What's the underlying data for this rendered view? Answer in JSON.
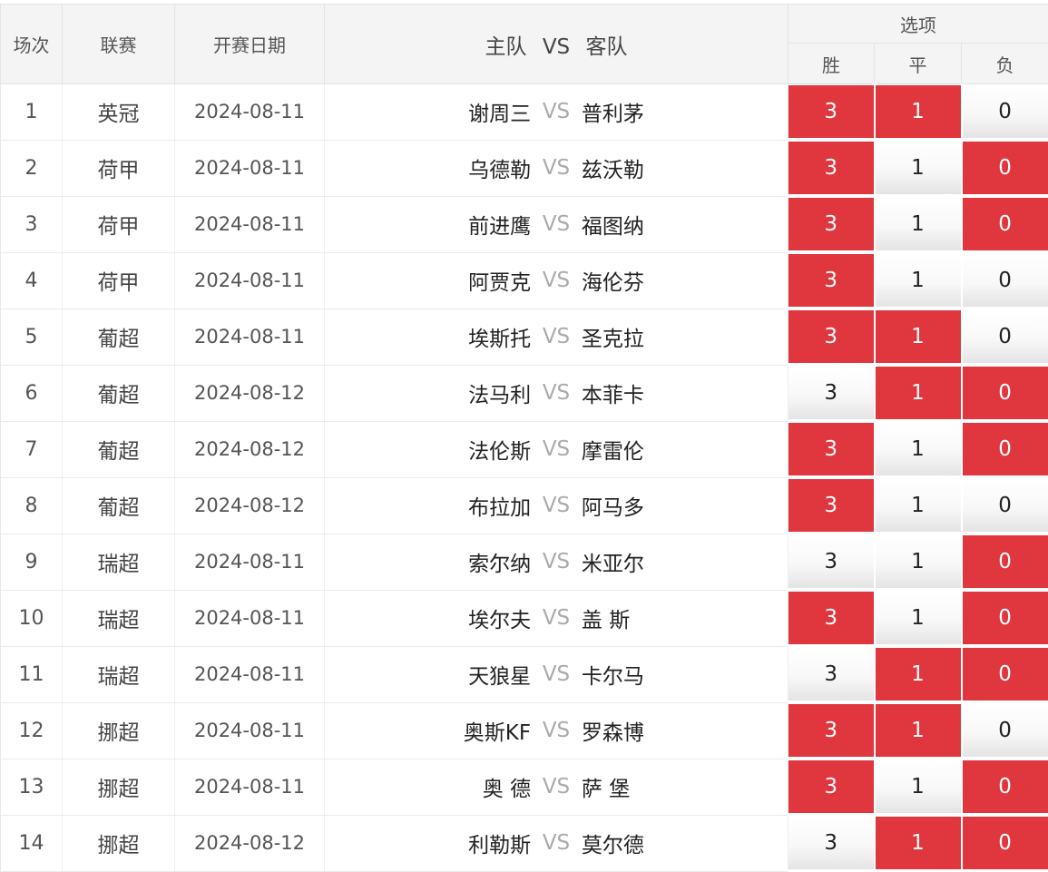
{
  "header": {
    "index": "场次",
    "league": "联赛",
    "date": "开赛日期",
    "match": {
      "home": "主队",
      "vs": "VS",
      "away": "客队"
    },
    "options": "选项",
    "win": "胜",
    "draw": "平",
    "lose": "负"
  },
  "vs_label": "VS",
  "colors": {
    "selected": "#e0363d",
    "vs_text": "#aaaaaa"
  },
  "rows": [
    {
      "index": "1",
      "league": "英冠",
      "date": "2024-08-11",
      "home": "谢周三",
      "away": "普利茅",
      "win": "3",
      "draw": "1",
      "lose": "0",
      "win_sel": true,
      "draw_sel": true,
      "lose_sel": false
    },
    {
      "index": "2",
      "league": "荷甲",
      "date": "2024-08-11",
      "home": "乌德勒",
      "away": "兹沃勒",
      "win": "3",
      "draw": "1",
      "lose": "0",
      "win_sel": true,
      "draw_sel": false,
      "lose_sel": true
    },
    {
      "index": "3",
      "league": "荷甲",
      "date": "2024-08-11",
      "home": "前进鹰",
      "away": "福图纳",
      "win": "3",
      "draw": "1",
      "lose": "0",
      "win_sel": true,
      "draw_sel": false,
      "lose_sel": true
    },
    {
      "index": "4",
      "league": "荷甲",
      "date": "2024-08-11",
      "home": "阿贾克",
      "away": "海伦芬",
      "win": "3",
      "draw": "1",
      "lose": "0",
      "win_sel": true,
      "draw_sel": false,
      "lose_sel": false
    },
    {
      "index": "5",
      "league": "葡超",
      "date": "2024-08-11",
      "home": "埃斯托",
      "away": "圣克拉",
      "win": "3",
      "draw": "1",
      "lose": "0",
      "win_sel": true,
      "draw_sel": true,
      "lose_sel": false
    },
    {
      "index": "6",
      "league": "葡超",
      "date": "2024-08-12",
      "home": "法马利",
      "away": "本菲卡",
      "win": "3",
      "draw": "1",
      "lose": "0",
      "win_sel": false,
      "draw_sel": true,
      "lose_sel": true
    },
    {
      "index": "7",
      "league": "葡超",
      "date": "2024-08-12",
      "home": "法伦斯",
      "away": "摩雷伦",
      "win": "3",
      "draw": "1",
      "lose": "0",
      "win_sel": true,
      "draw_sel": false,
      "lose_sel": true
    },
    {
      "index": "8",
      "league": "葡超",
      "date": "2024-08-12",
      "home": "布拉加",
      "away": "阿马多",
      "win": "3",
      "draw": "1",
      "lose": "0",
      "win_sel": true,
      "draw_sel": false,
      "lose_sel": false
    },
    {
      "index": "9",
      "league": "瑞超",
      "date": "2024-08-11",
      "home": "索尔纳",
      "away": "米亚尔",
      "win": "3",
      "draw": "1",
      "lose": "0",
      "win_sel": false,
      "draw_sel": false,
      "lose_sel": true
    },
    {
      "index": "10",
      "league": "瑞超",
      "date": "2024-08-11",
      "home": "埃尔夫",
      "away": "盖 斯",
      "win": "3",
      "draw": "1",
      "lose": "0",
      "win_sel": true,
      "draw_sel": false,
      "lose_sel": true
    },
    {
      "index": "11",
      "league": "瑞超",
      "date": "2024-08-11",
      "home": "天狼星",
      "away": "卡尔马",
      "win": "3",
      "draw": "1",
      "lose": "0",
      "win_sel": false,
      "draw_sel": true,
      "lose_sel": true
    },
    {
      "index": "12",
      "league": "挪超",
      "date": "2024-08-11",
      "home": "奥斯KF",
      "away": "罗森博",
      "win": "3",
      "draw": "1",
      "lose": "0",
      "win_sel": true,
      "draw_sel": true,
      "lose_sel": false
    },
    {
      "index": "13",
      "league": "挪超",
      "date": "2024-08-11",
      "home": "奥 德",
      "away": "萨 堡",
      "win": "3",
      "draw": "1",
      "lose": "0",
      "win_sel": true,
      "draw_sel": false,
      "lose_sel": true
    },
    {
      "index": "14",
      "league": "挪超",
      "date": "2024-08-12",
      "home": "利勒斯",
      "away": "莫尔德",
      "win": "3",
      "draw": "1",
      "lose": "0",
      "win_sel": false,
      "draw_sel": true,
      "lose_sel": true
    }
  ]
}
